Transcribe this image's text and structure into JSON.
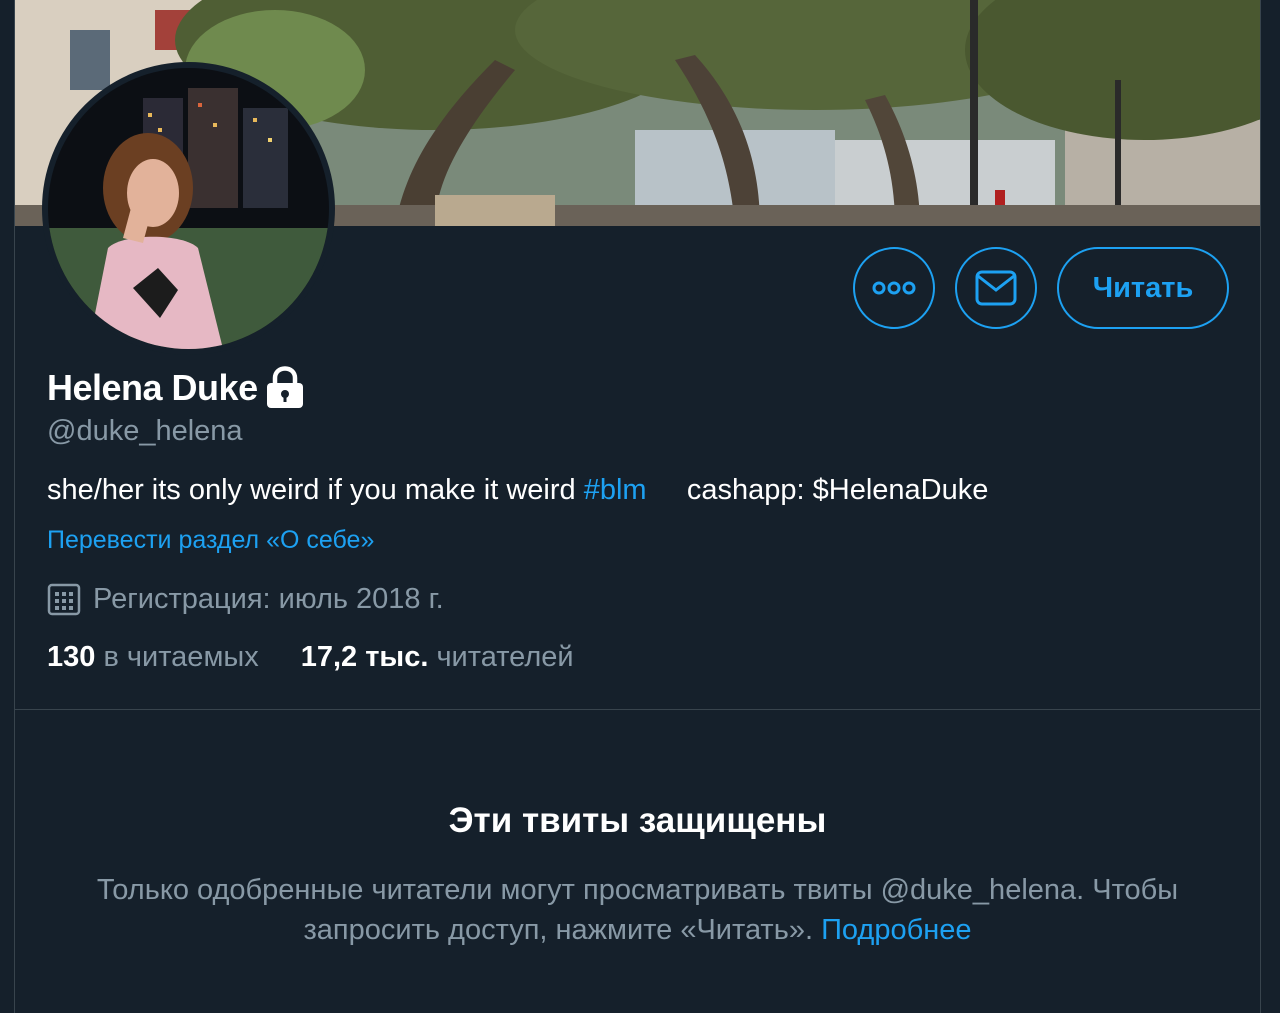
{
  "profile": {
    "display_name": "Helena Duke",
    "handle": "@duke_helena",
    "bio_text": "she/her its only weird if you make it weird ",
    "bio_hashtag": "#blm",
    "bio_cashapp": "cashapp: $HelenaDuke",
    "translate_bio": "Перевести раздел «О себе»",
    "joined": "Регистрация: июль 2018 г.",
    "following_count": "130",
    "following_label": "в читаемых",
    "followers_count": "17,2 тыс.",
    "followers_label": "читателей",
    "locked_icon": "lock-icon"
  },
  "actions": {
    "more_icon": "more-icon",
    "message_icon": "mail-icon",
    "follow_label": "Читать"
  },
  "protected": {
    "title": "Эти твиты защищены",
    "text": "Только одобренные читатели могут просматривать твиты @duke_helena. Чтобы запросить доступ, нажмите «Читать». ",
    "link": "Подробнее"
  },
  "colors": {
    "background": "#15202b",
    "accent": "#1da1f2",
    "secondary_text": "#8899a6",
    "border": "#38444d"
  }
}
